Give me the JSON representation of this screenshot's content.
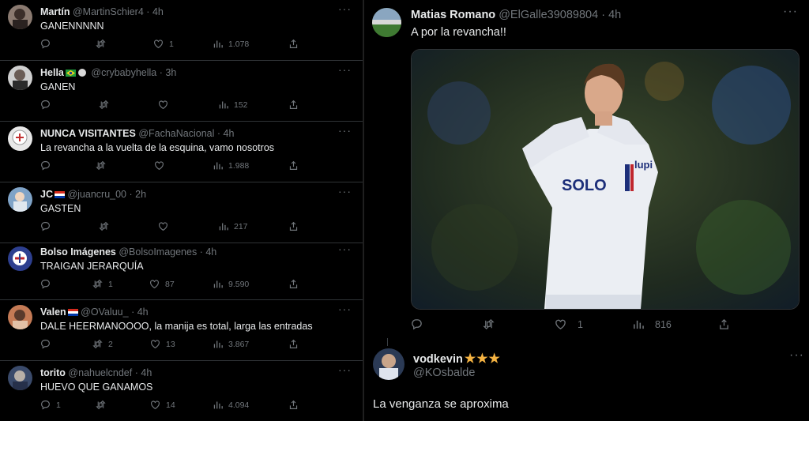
{
  "left_feed": [
    {
      "name": "Martín",
      "handle": "@MartinSchier4",
      "time": "4h",
      "text": "GANENNNNN",
      "replies": "",
      "retweets": "",
      "likes": "1",
      "views": "1.078"
    },
    {
      "name": "Hella",
      "handle": "@crybabyhella",
      "time": "3h",
      "text": "GANEN",
      "replies": "",
      "retweets": "",
      "likes": "",
      "views": "152"
    },
    {
      "name": "NUNCA VISITANTES",
      "handle": "@FachaNacional",
      "time": "4h",
      "text": "La revancha a la vuelta de la esquina, vamo nosotros",
      "replies": "",
      "retweets": "",
      "likes": "",
      "views": "1.988"
    },
    {
      "name": "JC",
      "handle": "@juancru_00",
      "time": "2h",
      "text": "GASTEN",
      "replies": "",
      "retweets": "",
      "likes": "",
      "views": "217"
    },
    {
      "name": "Bolso Imágenes",
      "handle": "@BolsoImagenes",
      "time": "4h",
      "text": "TRAIGAN JERARQUÍA",
      "replies": "",
      "retweets": "1",
      "likes": "87",
      "views": "9.590"
    },
    {
      "name": "Valen",
      "handle": "@OValuu_",
      "time": "4h",
      "text": "DALE HEERMANOOOO, la manija es total, larga las entradas",
      "replies": "",
      "retweets": "2",
      "likes": "13",
      "views": "3.867"
    },
    {
      "name": "torito",
      "handle": "@nahuelcndef",
      "time": "4h",
      "text": "HUEVO QUE GANAMOS",
      "replies": "1",
      "retweets": "",
      "likes": "14",
      "views": "4.094"
    }
  ],
  "main_tweet": {
    "name": "Matias Romano",
    "handle": "@ElGalle39089804",
    "time": "4h",
    "text": "A por la revancha!!",
    "replies": "",
    "retweets": "",
    "likes": "1",
    "views": "816",
    "jersey_text": "SOLO",
    "jersey_sponsor": "lupi"
  },
  "reply": {
    "name": "vodkevin",
    "stars": "★★★",
    "handle": "@KOsbalde",
    "text": "La venganza se aproxima"
  },
  "colors": {
    "background": "#000000",
    "text": "#e7e9ea",
    "muted": "#71767b",
    "border": "#2f3336",
    "stars": "#f5b342"
  },
  "icons": [
    "reply-icon",
    "retweet-icon",
    "like-icon",
    "views-icon",
    "share-icon",
    "more-icon",
    "brazil-flag-icon",
    "paraguay-flag-icon",
    "verified-badge-icon"
  ]
}
